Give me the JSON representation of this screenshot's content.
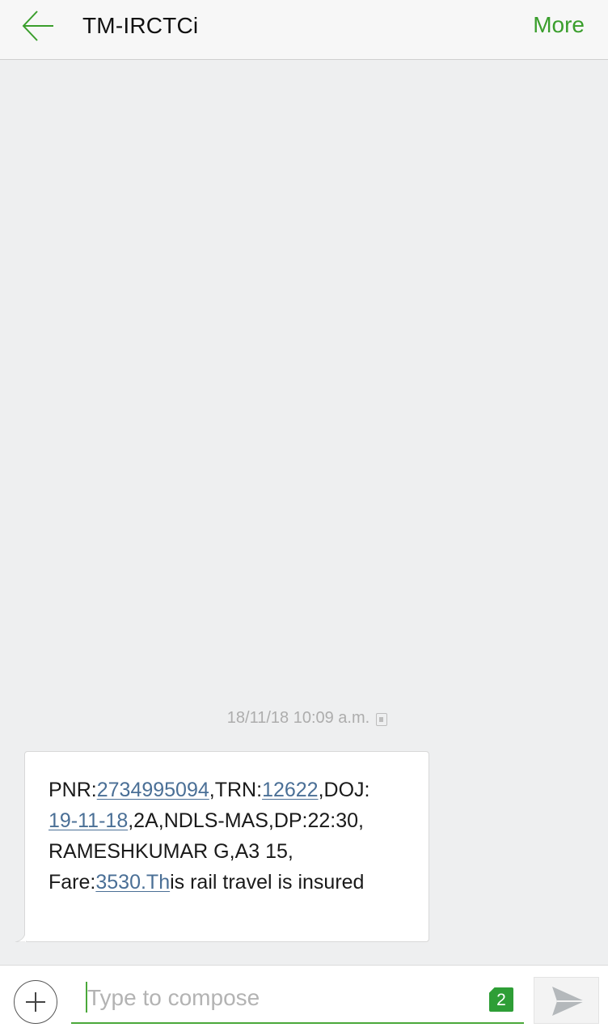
{
  "header": {
    "title": "TM-IRCTCi",
    "more_label": "More"
  },
  "conversation": {
    "timestamp": "18/11/18 10:09 a.m.",
    "message": {
      "l1_a": "PNR:",
      "l1_pnr": "2734995094",
      "l1_b": ",TRN:",
      "l1_trn": "12622",
      "l1_c": ",DOJ:",
      "l2_doj": "19-11-18",
      "l2_b": ",2A,NDLS-MAS,DP:22:30,",
      "l3": "RAMESHKUMAR G,A3 15,",
      "l4_a": "Fare:",
      "l4_link": "3530.Th",
      "l4_b": "is rail travel is insured"
    }
  },
  "composer": {
    "placeholder": "Type to compose",
    "sim_number": "2"
  },
  "colors": {
    "accent": "#3a9e2c",
    "link": "#4a6f96",
    "background": "#eeeff0"
  },
  "icons": {
    "back": "arrow-left-icon",
    "add": "plus-circle-icon",
    "send": "send-icon",
    "sim": "sim-icon"
  }
}
